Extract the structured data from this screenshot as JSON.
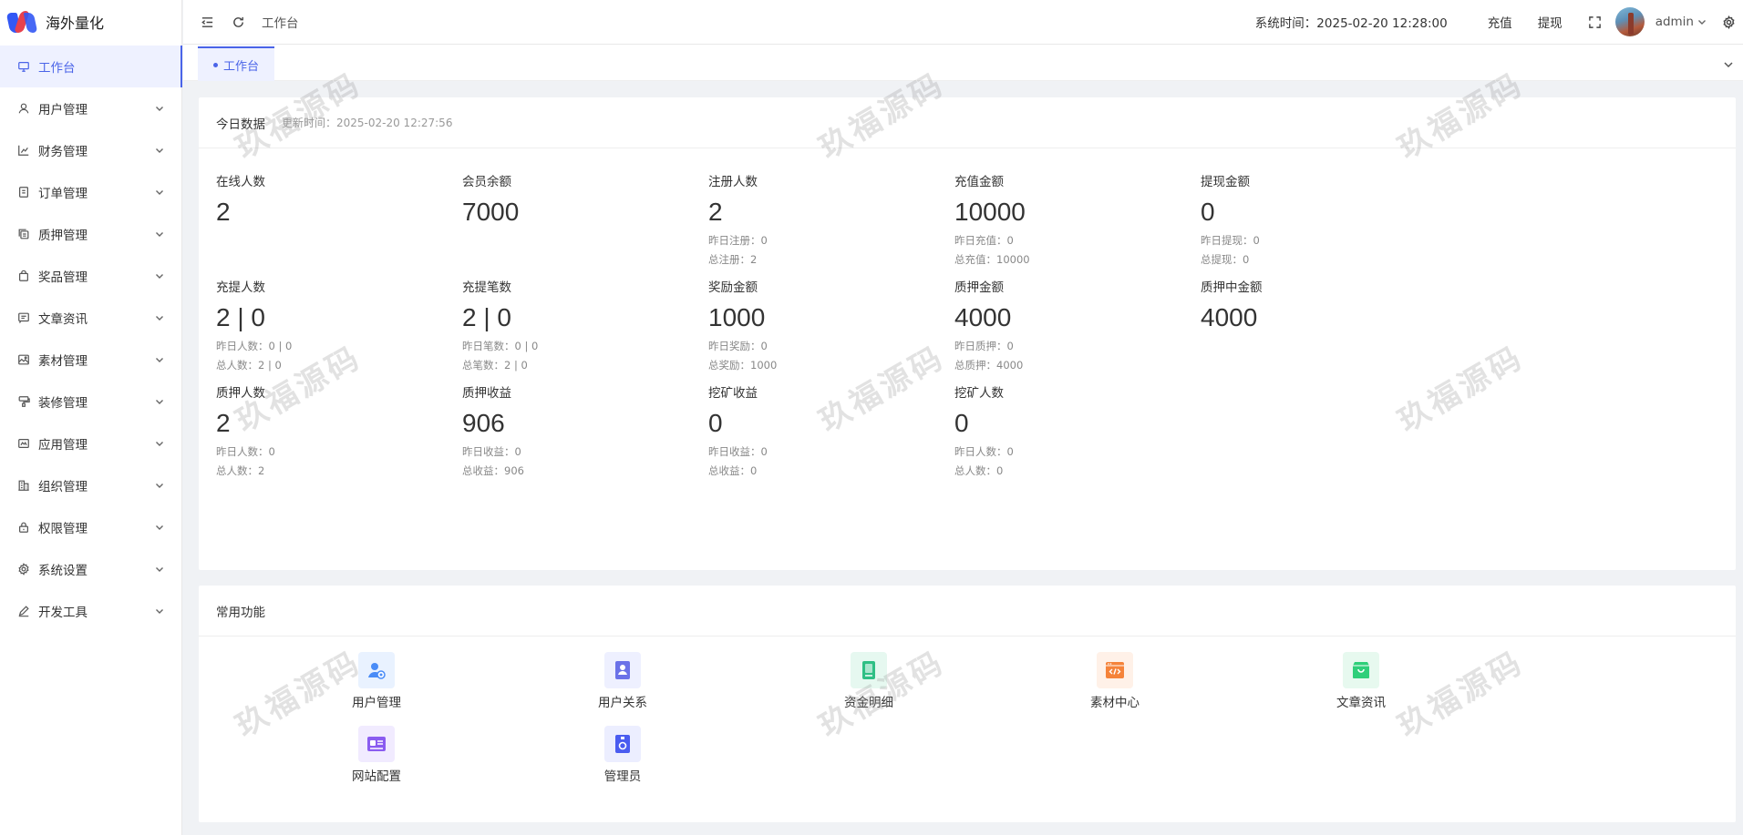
{
  "app": {
    "name": "海外量化"
  },
  "sidebar": {
    "items": [
      {
        "label": "工作台",
        "icon": "monitor-icon",
        "active": true
      },
      {
        "label": "用户管理",
        "icon": "user-icon"
      },
      {
        "label": "财务管理",
        "icon": "chart-icon"
      },
      {
        "label": "订单管理",
        "icon": "order-icon"
      },
      {
        "label": "质押管理",
        "icon": "copy-icon"
      },
      {
        "label": "奖品管理",
        "icon": "bag-icon"
      },
      {
        "label": "文章资讯",
        "icon": "message-icon"
      },
      {
        "label": "素材管理",
        "icon": "image-icon"
      },
      {
        "label": "装修管理",
        "icon": "paint-icon"
      },
      {
        "label": "应用管理",
        "icon": "app-icon"
      },
      {
        "label": "组织管理",
        "icon": "building-icon"
      },
      {
        "label": "权限管理",
        "icon": "lock-icon"
      },
      {
        "label": "系统设置",
        "icon": "gear-icon"
      },
      {
        "label": "开发工具",
        "icon": "pen-icon"
      }
    ]
  },
  "header": {
    "breadcrumb": "工作台",
    "system_time": "系统时间：2025-02-20 12:28:00",
    "recharge": "充值",
    "withdraw": "提现",
    "username": "admin"
  },
  "tabs": [
    {
      "label": "工作台"
    }
  ],
  "stats_card": {
    "title": "今日数据",
    "updated": "更新时间：2025-02-20 12:27:56",
    "items": [
      {
        "label": "在线人数",
        "value": "2",
        "sub": []
      },
      {
        "label": "会员余额",
        "value": "7000",
        "sub": []
      },
      {
        "label": "注册人数",
        "value": "2",
        "sub": [
          "昨日注册：0",
          "总注册：2"
        ]
      },
      {
        "label": "充值金额",
        "value": "10000",
        "sub": [
          "昨日充值：0",
          "总充值：10000"
        ]
      },
      {
        "label": "提现金额",
        "value": "0",
        "sub": [
          "昨日提现：0",
          "总提现：0"
        ]
      },
      {
        "label": "充提人数",
        "value": "2 | 0",
        "sub": [
          "昨日人数：0 | 0",
          "总人数：2 | 0"
        ]
      },
      {
        "label": "充提笔数",
        "value": "2 | 0",
        "sub": [
          "昨日笔数：0 | 0",
          "总笔数：2 | 0"
        ]
      },
      {
        "label": "奖励金额",
        "value": "1000",
        "sub": [
          "昨日奖励：0",
          "总奖励：1000"
        ]
      },
      {
        "label": "质押金额",
        "value": "4000",
        "sub": [
          "昨日质押：0",
          "总质押：4000"
        ]
      },
      {
        "label": "质押中金额",
        "value": "4000",
        "sub": []
      },
      {
        "label": "质押人数",
        "value": "2",
        "sub": [
          "昨日人数：0",
          "总人数：2"
        ]
      },
      {
        "label": "质押收益",
        "value": "906",
        "sub": [
          "昨日收益：0",
          "总收益：906"
        ]
      },
      {
        "label": "挖矿收益",
        "value": "0",
        "sub": [
          "昨日收益：0",
          "总收益：0"
        ]
      },
      {
        "label": "挖矿人数",
        "value": "0",
        "sub": [
          "昨日人数：0",
          "总人数：0"
        ]
      }
    ]
  },
  "functions_card": {
    "title": "常用功能",
    "items": [
      {
        "label": "用户管理",
        "icon": "user-settings-icon",
        "color": "#4a8cf7",
        "bg": "#e9f2ff"
      },
      {
        "label": "用户关系",
        "icon": "user-relation-icon",
        "color": "#6b72e8",
        "bg": "#eef0ff"
      },
      {
        "label": "资金明细",
        "icon": "ledger-icon",
        "color": "#2fbf85",
        "bg": "#e6f8f0"
      },
      {
        "label": "素材中心",
        "icon": "code-window-icon",
        "color": "#f5833a",
        "bg": "#fff1e8"
      },
      {
        "label": "文章资讯",
        "icon": "box-icon",
        "color": "#2fcf7a",
        "bg": "#e7f9ef"
      },
      {
        "label": "网站配置",
        "icon": "id-card-icon",
        "color": "#8a5cf0",
        "bg": "#f1ebff"
      },
      {
        "label": "管理员",
        "icon": "badge-icon",
        "color": "#4a5cf0",
        "bg": "#eceeff"
      }
    ]
  },
  "watermark": "玖福源码"
}
